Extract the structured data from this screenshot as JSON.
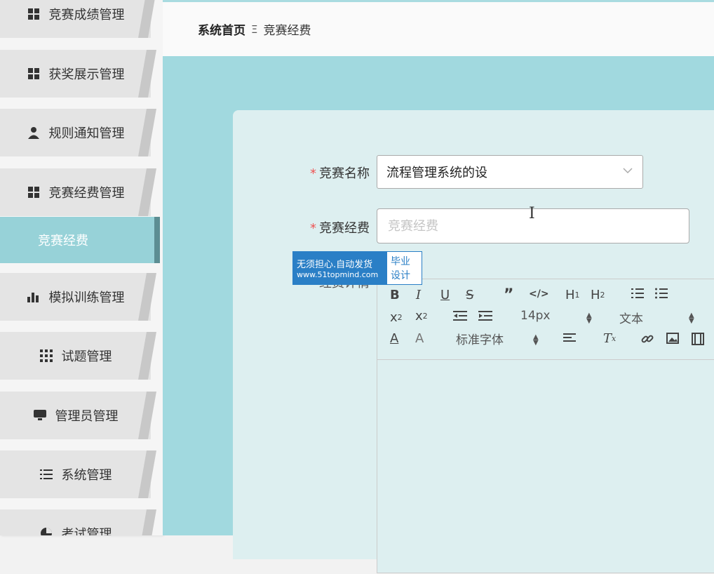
{
  "sidebar": {
    "items": [
      {
        "label": "竞赛成绩管理",
        "icon": "grid-icon"
      },
      {
        "label": "获奖展示管理",
        "icon": "grid-icon"
      },
      {
        "label": "规则通知管理",
        "icon": "user-icon"
      },
      {
        "label": "竞赛经费管理",
        "icon": "grid-icon"
      },
      {
        "label": "模拟训练管理",
        "icon": "bar-chart-icon"
      },
      {
        "label": "试题管理",
        "icon": "apps-icon"
      },
      {
        "label": "管理员管理",
        "icon": "monitor-icon"
      },
      {
        "label": "系统管理",
        "icon": "list-icon"
      },
      {
        "label": "考试管理",
        "icon": "pie-icon"
      }
    ],
    "active_sub": "竞赛经费"
  },
  "breadcrumb": {
    "home": "系统首页",
    "separator": "Ξ",
    "current": "竞赛经费"
  },
  "form": {
    "name_label": "竞赛名称",
    "name_value": "流程管理系统的设",
    "fee_label": "竞赛经费",
    "fee_placeholder": "竞赛经费",
    "detail_label": "经费详情",
    "required_mark": "*"
  },
  "editor": {
    "font_size": "14px",
    "text_type": "文本",
    "font_family": "标准字体"
  },
  "watermark": {
    "line1": "无须担心.自动发货",
    "line2": "www.51topmind.com",
    "right1": "毕业",
    "right2": "设计"
  },
  "colors": {
    "accent": "#a1d9df",
    "active_sub": "#97d2d8",
    "required": "#ee5555"
  }
}
